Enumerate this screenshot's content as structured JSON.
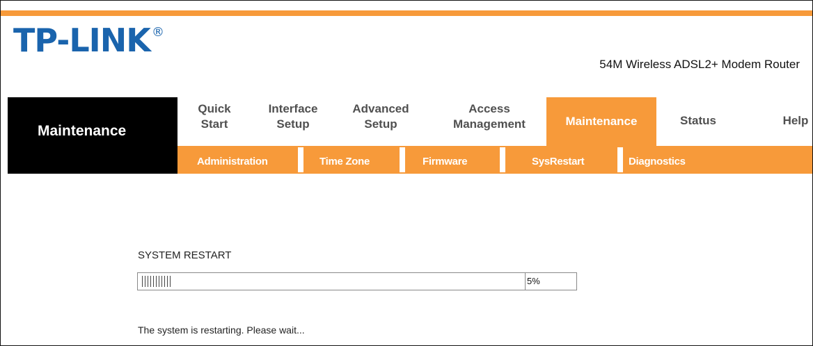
{
  "brand": {
    "logo_text": "TP-LINK",
    "registered_mark": "®",
    "product_name": "54M Wireless ADSL2+ Modem Router"
  },
  "page": {
    "section_label": "Maintenance"
  },
  "nav": {
    "items": [
      {
        "label": "Quick\nStart",
        "active": false
      },
      {
        "label": "Interface\nSetup",
        "active": false
      },
      {
        "label": "Advanced\nSetup",
        "active": false
      },
      {
        "label": "Access\nManagement",
        "active": false
      },
      {
        "label": "Maintenance",
        "active": true
      },
      {
        "label": "Status",
        "active": false
      },
      {
        "label": "Help",
        "active": false
      }
    ]
  },
  "subnav": {
    "items": [
      "Administration",
      "Time Zone",
      "Firmware",
      "SysRestart",
      "Diagnostics"
    ]
  },
  "restart": {
    "title": "SYSTEM RESTART",
    "progress_percent": 5,
    "progress_label": "5%",
    "message": "The system is restarting. Please wait..."
  },
  "colors": {
    "accent_orange": "#f79a3a",
    "brand_blue": "#1a64ad",
    "black": "#000000"
  }
}
